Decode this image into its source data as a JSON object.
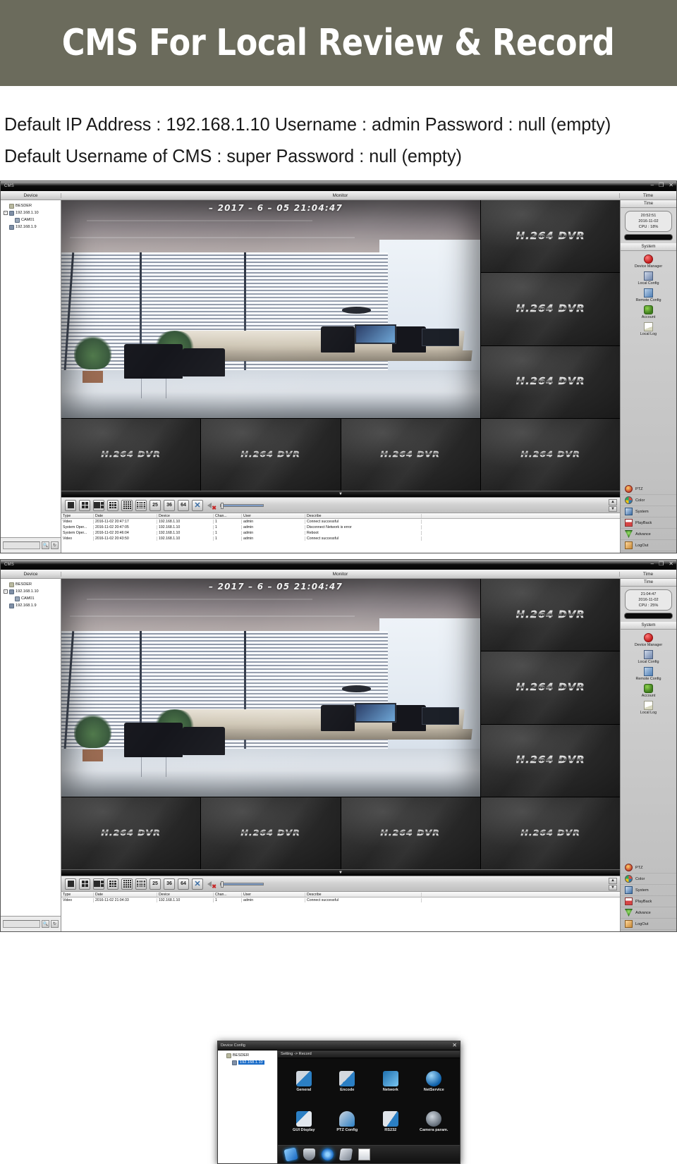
{
  "banner": {
    "title": "CMS For Local Review & Record",
    "bg": "#6b6b5c"
  },
  "info": {
    "line1": "Default IP Address : 192.168.1.10   Username : admin Password : null (empty)",
    "line2": "Default Username of CMS : super Password : null (empty)"
  },
  "window": {
    "title": "CMS",
    "min_label": "–",
    "max_label": "❐",
    "close_label": "✕",
    "headers": {
      "device": "Device",
      "monitor": "Monitor",
      "time": "Time"
    }
  },
  "device_tree": [
    {
      "label": "BESDER",
      "icon": "folder-icon",
      "indent": 0,
      "expander": ""
    },
    {
      "label": "192.168.1.10",
      "icon": "dvr-icon",
      "indent": 0,
      "expander": "-"
    },
    {
      "label": "CAM01",
      "icon": "camera-icon",
      "indent": 2,
      "expander": ""
    },
    {
      "label": "192.168.1.9",
      "icon": "dvr-icon",
      "indent": 0,
      "expander": ""
    }
  ],
  "device_search": {
    "placeholder": "",
    "value": "",
    "search_icon": "magnifier-icon",
    "refresh_icon": "refresh-icon"
  },
  "video": {
    "timestamp": "–  2017 – 6 – 05  21:04:47",
    "dvr_watermark": "H.264 DVR"
  },
  "toolbar": {
    "split_buttons": [
      "1",
      "4",
      "6",
      "9",
      "16",
      "20",
      "25",
      "36",
      "64"
    ],
    "fullscreen_label": "✕",
    "mute_icon": "speaker-muted-icon",
    "volume_value": 0,
    "scroll_up": "▲",
    "scroll_down": "▼",
    "collapse_icon": "chevron-down-icon"
  },
  "log": {
    "columns": [
      "Type",
      "Date",
      "Device",
      "Chan...",
      "User",
      "Describe",
      ""
    ],
    "rows_window1": [
      [
        "Video",
        "2016-11-02 20:47:17",
        "192.168.1.10",
        "1",
        "admin",
        "Connect successful",
        ""
      ],
      [
        "System Oper...",
        "2016-11-02 20:47:05",
        "192.168.1.10",
        "1",
        "admin",
        "Disconnect Network is error",
        ""
      ],
      [
        "System Oper...",
        "2016-11-02 20:46:04",
        "192.168.1.10",
        "1",
        "admin",
        "Reboot",
        ""
      ],
      [
        "Video",
        "2016-11-02 20:43:50",
        "192.168.1.10",
        "1",
        "admin",
        "Connect successful",
        ""
      ]
    ],
    "rows_window2": [
      [
        "Video",
        "2016-11-02 21:04:33",
        "192.168.1.10",
        "1",
        "admin",
        "Connect successful",
        ""
      ]
    ]
  },
  "sidebar": {
    "time_section_label": "Time",
    "system_section_label": "System",
    "clock_window1": {
      "time": "20:52:51",
      "date": "2016-11-02",
      "cpu": "CPU : 18%"
    },
    "clock_window2": {
      "time": "21:04:47",
      "date": "2016-11-02",
      "cpu": "CPU : 25%"
    },
    "system_items": [
      {
        "label": "Device Manager",
        "icon": "record-dot-icon"
      },
      {
        "label": "Local Config",
        "icon": "local-config-icon"
      },
      {
        "label": "Remote Config",
        "icon": "remote-config-icon"
      },
      {
        "label": "Account",
        "icon": "account-icon"
      },
      {
        "label": "Local Log",
        "icon": "local-log-icon"
      }
    ],
    "bottom_items": [
      {
        "label": "PTZ",
        "icon": "ptz-icon"
      },
      {
        "label": "Color",
        "icon": "color-wheel-icon"
      },
      {
        "label": "System",
        "icon": "system-icon"
      },
      {
        "label": "PlayBack",
        "icon": "playback-icon"
      },
      {
        "label": "Advance",
        "icon": "advance-icon"
      },
      {
        "label": "LogOut",
        "icon": "logout-icon"
      }
    ]
  },
  "dialog": {
    "title": "Device Config",
    "close_label": "✕",
    "breadcrumb": "Setting -> Record",
    "tree": [
      {
        "label": "BESDER",
        "icon": "folder-icon",
        "selected": false
      },
      {
        "label": "192.168.1.10",
        "icon": "dvr-icon",
        "selected": true
      }
    ],
    "icons": [
      {
        "label": "General",
        "icon": "wrench-gear-icon"
      },
      {
        "label": "Encode",
        "icon": "encode-gear-icon"
      },
      {
        "label": "Network",
        "icon": "network-icon"
      },
      {
        "label": "NetService",
        "icon": "globe-icon"
      },
      {
        "label": "GUI Display",
        "icon": "gui-display-icon"
      },
      {
        "label": "PTZ Config",
        "icon": "ptz-camera-icon"
      },
      {
        "label": "RS232",
        "icon": "rs232-plug-icon"
      },
      {
        "label": "Camera param.",
        "icon": "camera-gear-icon"
      }
    ],
    "tabs": [
      {
        "icon": "record-tab-icon"
      },
      {
        "icon": "alarm-shield-icon"
      },
      {
        "icon": "settings-gear-icon"
      },
      {
        "icon": "advanced-tools-icon"
      },
      {
        "icon": "info-list-icon"
      }
    ]
  }
}
